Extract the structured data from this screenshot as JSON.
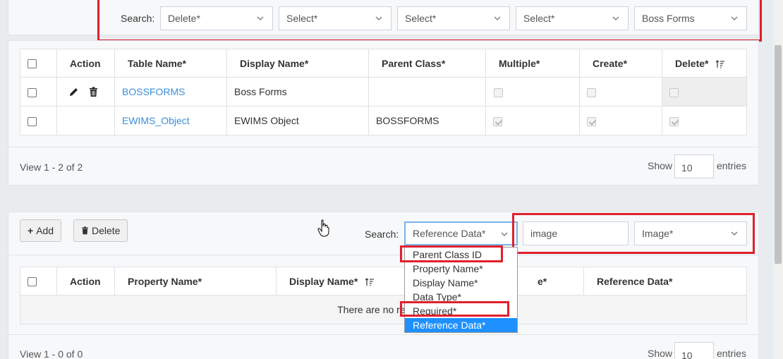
{
  "top_filter": {
    "search_label": "Search:",
    "selects": [
      "Delete*",
      "Select*",
      "Select*",
      "Select*",
      "Boss Forms"
    ]
  },
  "forms_table": {
    "headers": [
      "Action",
      "Table Name*",
      "Display Name*",
      "Parent Class*",
      "Multiple*",
      "Create*",
      "Delete*"
    ],
    "rows": [
      {
        "table_name": "BOSSFORMS",
        "display_name": "Boss Forms",
        "parent_class": ""
      },
      {
        "table_name": "EWIMS_Object",
        "display_name": "EWIMS Object",
        "parent_class": "BOSSFORMS"
      }
    ],
    "footer_view": "View 1 - 2 of 2",
    "show_label": "Show",
    "entries_value": "10",
    "entries_label": "entries"
  },
  "properties": {
    "add_label": "Add",
    "delete_label": "Delete",
    "search_label": "Search:",
    "field_select": "Reference Data*",
    "search_value": "image",
    "type_select": "Image*",
    "dropdown_options": [
      "Parent Class ID",
      "Property Name*",
      "Display Name*",
      "Data Type*",
      "Required*",
      "Reference Data*"
    ],
    "headers": [
      "Action",
      "Property Name*",
      "Display Name*",
      "e*",
      "Reference Data*"
    ],
    "empty_message": "There are no records",
    "footer_view": "View 1 - 0 of 0",
    "show_label": "Show",
    "entries_value": "10",
    "entries_label": "entries"
  },
  "colors": {
    "highlight": "#e01f2d",
    "link": "#3a8fd9",
    "selected_option": "#1e90ff"
  }
}
